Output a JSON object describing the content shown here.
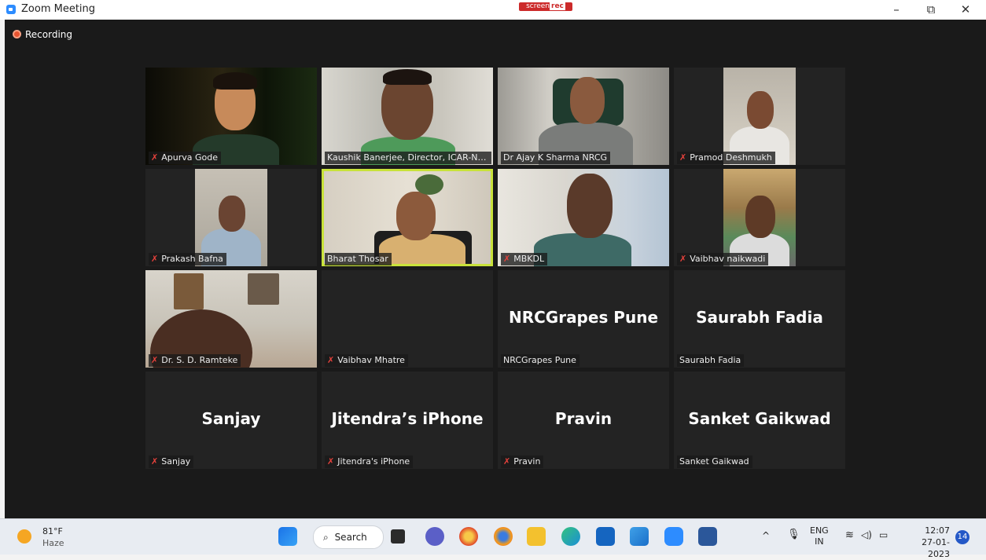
{
  "window": {
    "title": "Zoom Meeting",
    "minimize": "–",
    "restore": "⧉",
    "close": "✕"
  },
  "overlay": {
    "brand_left": "screen",
    "brand_right": "rec"
  },
  "recording": {
    "label": "Recording"
  },
  "participants": [
    {
      "name": "Apurva Gode",
      "muted": true,
      "video": true
    },
    {
      "name": "Kaushik Banerjee, Director, ICAR-NR...",
      "muted": false,
      "video": true
    },
    {
      "name": "Dr Ajay K Sharma NRCG",
      "muted": false,
      "video": true
    },
    {
      "name": "Pramod Deshmukh",
      "muted": true,
      "video": true
    },
    {
      "name": "Prakash Bafna",
      "muted": true,
      "video": true
    },
    {
      "name": "Bharat Thosar",
      "muted": false,
      "video": true,
      "active_speaker": true
    },
    {
      "name": "MBKDL",
      "muted": true,
      "video": true
    },
    {
      "name": "Vaibhav naikwadi",
      "muted": true,
      "video": true
    },
    {
      "name": "Dr. S. D. Ramteke",
      "muted": true,
      "video": true
    },
    {
      "name": "Vaibhav Mhatre",
      "muted": true,
      "video": false,
      "display_name": ""
    },
    {
      "name": "NRCGrapes Pune",
      "muted": false,
      "video": false,
      "display_name": "NRCGrapes Pune"
    },
    {
      "name": "Saurabh Fadia",
      "muted": false,
      "video": false,
      "display_name": "Saurabh Fadia"
    },
    {
      "name": "Sanjay",
      "muted": true,
      "video": false,
      "display_name": "Sanjay"
    },
    {
      "name": "Jitendra's iPhone",
      "muted": true,
      "video": false,
      "display_name": "Jitendra’s iPhone"
    },
    {
      "name": "Pravin",
      "muted": true,
      "video": false,
      "display_name": "Pravin"
    },
    {
      "name": "Sanket Gaikwad",
      "muted": false,
      "video": false,
      "display_name": "Sanket Gaikwad"
    }
  ],
  "taskbar": {
    "weather": {
      "temp": "81°F",
      "condition": "Haze"
    },
    "search_label": "Search",
    "lang": {
      "line1": "ENG",
      "line2": "IN"
    },
    "time": "12:07",
    "date": "27-01-2023",
    "notification_count": "14"
  },
  "colors": {
    "accent": "#2d8cff",
    "speaker_border": "#c8e23a",
    "muted_mic": "#e8423c"
  }
}
